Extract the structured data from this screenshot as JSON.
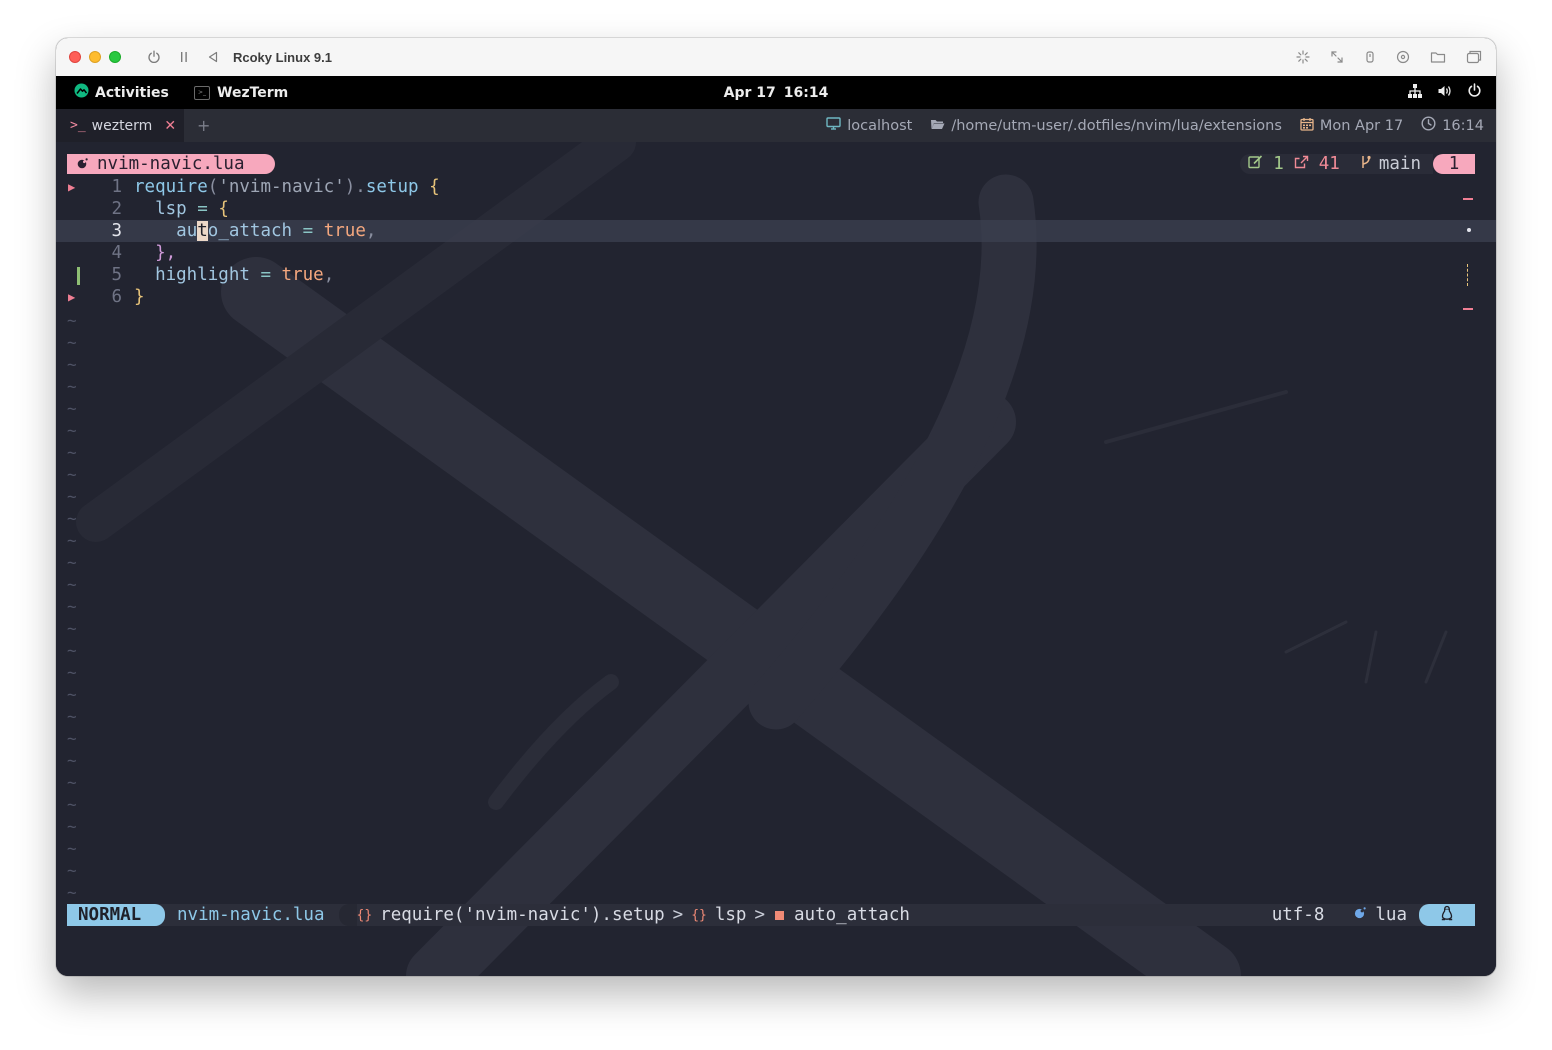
{
  "vm": {
    "title": "Rcoky Linux 9.1"
  },
  "gnome": {
    "activities": "Activities",
    "app_name": "WezTerm",
    "date": "Apr 17",
    "time": "16:14"
  },
  "wezterm": {
    "tab_label": "wezterm",
    "tab_close": "✕",
    "new_tab": "+",
    "status": {
      "host": "localhost",
      "cwd": "/home/utm-user/.dotfiles/nvim/lua/extensions",
      "date": "Mon Apr 17",
      "time": "16:14"
    }
  },
  "nvim": {
    "winbar": {
      "filename": "nvim-navic.lua",
      "git_added": "1",
      "git_modified": "41",
      "branch": "main",
      "diagnostics": "1"
    },
    "line_numbers": [
      "1",
      "2",
      "3",
      "4",
      "5",
      "6"
    ],
    "code": {
      "l1_require": "require",
      "l1_open": "(",
      "l1_string": "'nvim-navic'",
      "l1_close": ")",
      "l1_dot": ".",
      "l1_setup": "setup",
      "l1_brace": "{",
      "l2_lsp": "lsp",
      "l2_eq": "=",
      "l2_brace": "{",
      "l3_pre": "au",
      "l3_cursor": "t",
      "l3_post": "o_attach",
      "l3_eq": "=",
      "l3_true": "true",
      "l3_comma": ",",
      "l4_close": "},",
      "l5_highlight": "highlight",
      "l5_eq": "=",
      "l5_true": "true",
      "l5_comma": ",",
      "l6_close": "}"
    },
    "filler_char": "~",
    "statusline": {
      "mode": "NORMAL",
      "filename": "nvim-navic.lua",
      "breadcrumb_1": "require('nvim-navic').setup",
      "breadcrumb_2": "lsp",
      "breadcrumb_3": "auto_attach",
      "breadcrumb_sep": ">",
      "encoding": "utf-8",
      "filetype": "lua"
    }
  },
  "colors": {
    "accent_pink": "#f7a8bd",
    "accent_blue": "#8ec8e8",
    "terminal_bg": "#222430",
    "git_add": "#a3c98a",
    "git_mod": "#ef8a96"
  }
}
